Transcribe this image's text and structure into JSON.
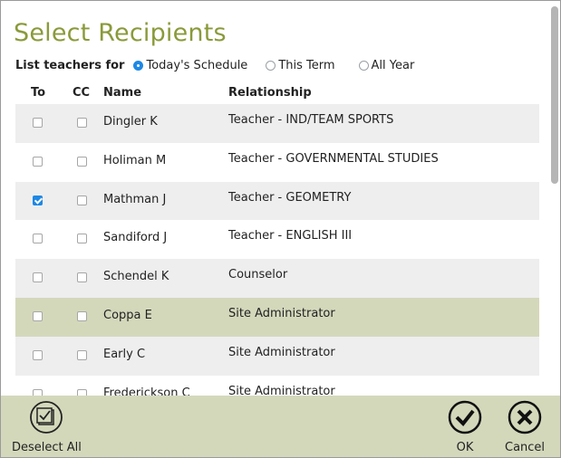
{
  "title": "Select Recipients",
  "filter": {
    "label": "List teachers for",
    "options": [
      {
        "label": "Today's Schedule",
        "selected": true
      },
      {
        "label": "This Term",
        "selected": false
      },
      {
        "label": "All Year",
        "selected": false
      }
    ]
  },
  "columns": {
    "to": "To",
    "cc": "CC",
    "name": "Name",
    "relationship": "Relationship"
  },
  "rows": [
    {
      "name": "Dingler K",
      "relationship": "Teacher - IND/TEAM SPORTS",
      "to": false,
      "cc": false
    },
    {
      "name": "Holiman M",
      "relationship": "Teacher - GOVERNMENTAL STUDIES",
      "to": false,
      "cc": false
    },
    {
      "name": "Mathman J",
      "relationship": "Teacher - GEOMETRY",
      "to": true,
      "cc": false
    },
    {
      "name": "Sandiford J",
      "relationship": "Teacher - ENGLISH III",
      "to": false,
      "cc": false
    },
    {
      "name": "Schendel K",
      "relationship": "Counselor",
      "to": false,
      "cc": false
    },
    {
      "name": "Coppa E",
      "relationship": "Site Administrator",
      "to": false,
      "cc": false
    },
    {
      "name": "Early C",
      "relationship": "Site Administrator",
      "to": false,
      "cc": false
    },
    {
      "name": "Frederickson C",
      "relationship": "Site Administrator",
      "to": false,
      "cc": false
    }
  ],
  "footer": {
    "deselect_all": "Deselect All",
    "ok": "OK",
    "cancel": "Cancel"
  },
  "colors": {
    "title": "#8a9a3a",
    "footer_bg": "#d4d8bb",
    "selected_row": "#d4d8bb",
    "checkbox_on": "#1e88e5"
  }
}
